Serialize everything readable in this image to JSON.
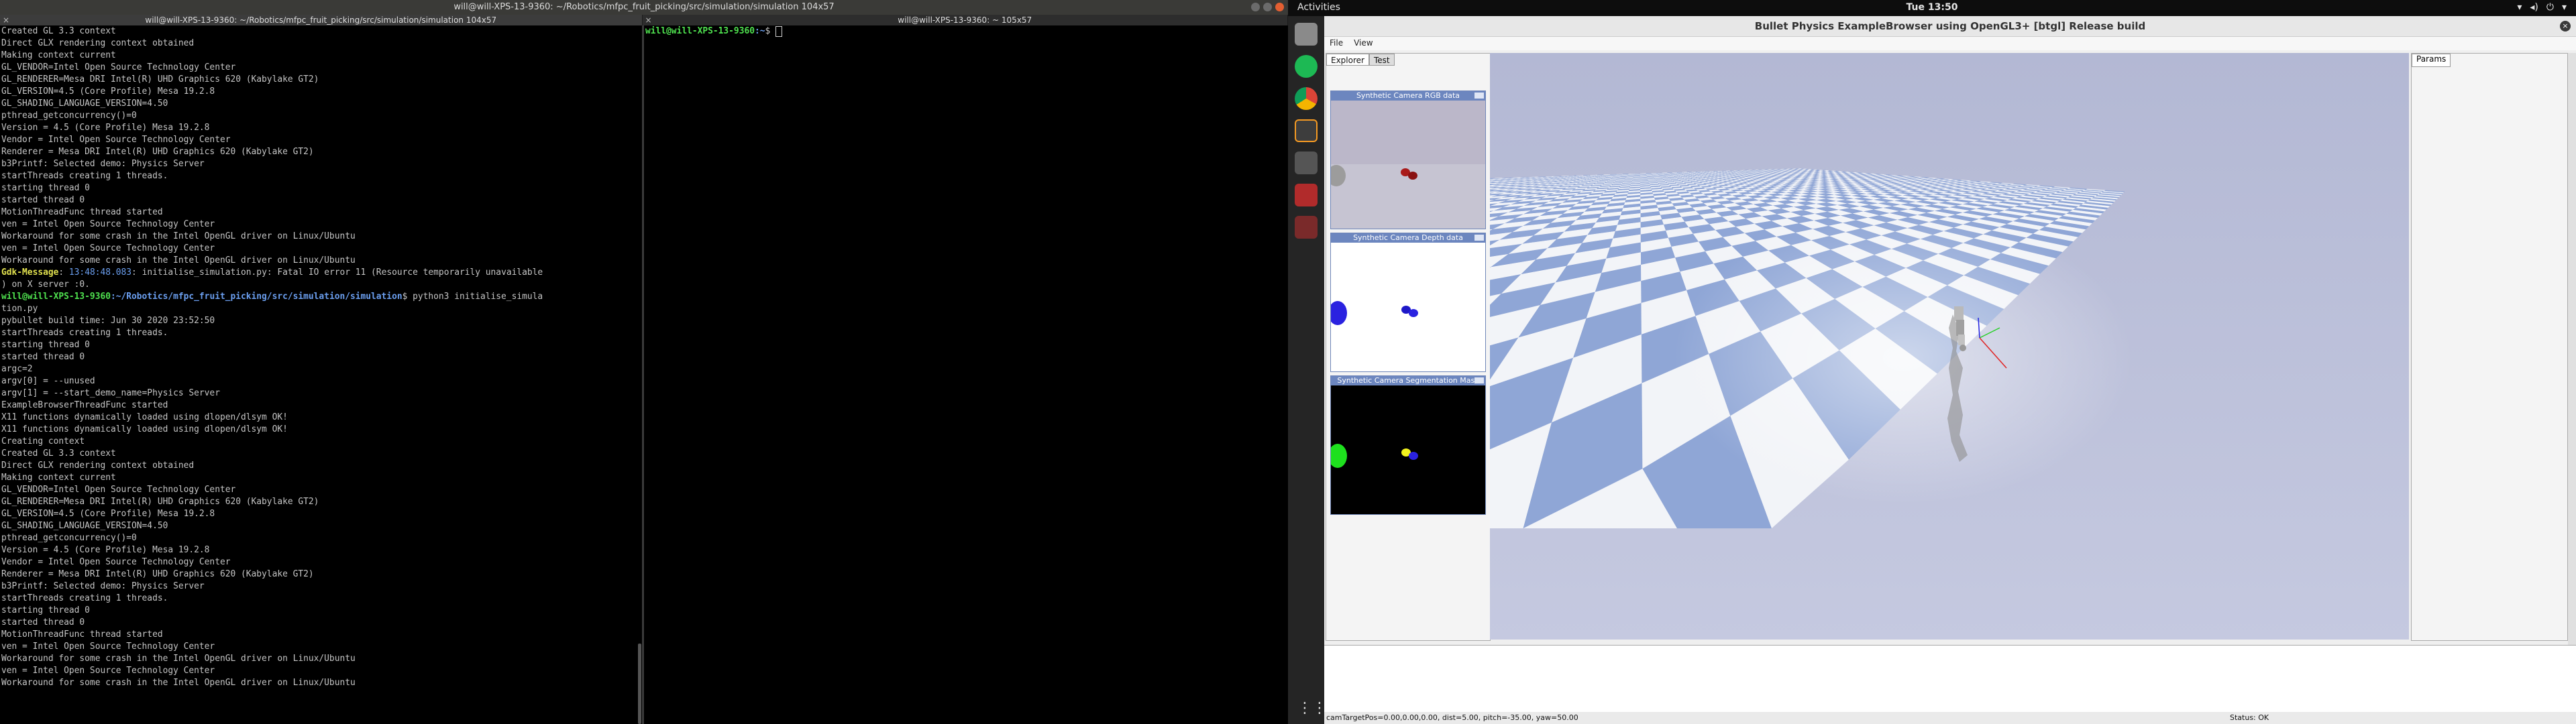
{
  "left_window": {
    "title": "will@will-XPS-13-9360: ~/Robotics/mfpc_fruit_picking/src/simulation/simulation 104x57",
    "tab_left": "will@will-XPS-13-9360: ~/Robotics/mfpc_fruit_picking/src/simulation/simulation 104x57",
    "tab_right": "will@will-XPS-13-9360: ~ 105x57",
    "close_glyph": "×",
    "lines_top": [
      "Created GL 3.3 context",
      "Direct GLX rendering context obtained",
      "Making context current",
      "GL_VENDOR=Intel Open Source Technology Center",
      "GL_RENDERER=Mesa DRI Intel(R) UHD Graphics 620 (Kabylake GT2)",
      "GL_VERSION=4.5 (Core Profile) Mesa 19.2.8",
      "GL_SHADING_LANGUAGE_VERSION=4.50",
      "pthread_getconcurrency()=0",
      "Version = 4.5 (Core Profile) Mesa 19.2.8",
      "Vendor = Intel Open Source Technology Center",
      "Renderer = Mesa DRI Intel(R) UHD Graphics 620 (Kabylake GT2)",
      "b3Printf: Selected demo: Physics Server",
      "startThreads creating 1 threads.",
      "starting thread 0",
      "started thread 0",
      "MotionThreadFunc thread started",
      "ven = Intel Open Source Technology Center",
      "Workaround for some crash in the Intel OpenGL driver on Linux/Ubuntu",
      "ven = Intel Open Source Technology Center",
      "Workaround for some crash in the Intel OpenGL driver on Linux/Ubuntu"
    ],
    "gdk_label": "Gdk-Message",
    "gdk_time": "13:48:48.083",
    "gdk_rest": ": initialise_simulation.py: Fatal IO error 11 (Resource temporarily unavailable",
    "gdk_cont": ") on X server :0.",
    "prompt_user": "will@will-XPS-13-9360",
    "prompt_path": ":~/Robotics/mfpc_fruit_picking/src/simulation/simulation",
    "prompt_cmd": "$ python3 initialise_simula",
    "prompt_cmd_cont": "tion.py",
    "lines_bottom": [
      "pybullet build time: Jun 30 2020 23:52:50",
      "startThreads creating 1 threads.",
      "starting thread 0",
      "started thread 0",
      "argc=2",
      "argv[0] = --unused",
      "argv[1] = --start_demo_name=Physics Server",
      "ExampleBrowserThreadFunc started",
      "X11 functions dynamically loaded using dlopen/dlsym OK!",
      "X11 functions dynamically loaded using dlopen/dlsym OK!",
      "Creating context",
      "Created GL 3.3 context",
      "Direct GLX rendering context obtained",
      "Making context current",
      "GL_VENDOR=Intel Open Source Technology Center",
      "GL_RENDERER=Mesa DRI Intel(R) UHD Graphics 620 (Kabylake GT2)",
      "GL_VERSION=4.5 (Core Profile) Mesa 19.2.8",
      "GL_SHADING_LANGUAGE_VERSION=4.50",
      "pthread_getconcurrency()=0",
      "Version = 4.5 (Core Profile) Mesa 19.2.8",
      "Vendor = Intel Open Source Technology Center",
      "Renderer = Mesa DRI Intel(R) UHD Graphics 620 (Kabylake GT2)",
      "b3Printf: Selected demo: Physics Server",
      "startThreads creating 1 threads.",
      "starting thread 0",
      "started thread 0",
      "MotionThreadFunc thread started",
      "ven = Intel Open Source Technology Center",
      "Workaround for some crash in the Intel OpenGL driver on Linux/Ubuntu",
      "ven = Intel Open Source Technology Center",
      "Workaround for some crash in the Intel OpenGL driver on Linux/Ubuntu"
    ],
    "right_prompt_user": "will@will-XPS-13-9360",
    "right_prompt_path": ":~",
    "right_prompt_sym": "$ "
  },
  "topbar": {
    "activities": "Activities",
    "clock": "Tue 13:50",
    "tray": [
      "▾",
      "◂)",
      "⏻",
      "▾"
    ]
  },
  "dock": {
    "apps_glyph": "⋮⋮⋮"
  },
  "app": {
    "title": "Bullet Physics ExampleBrowser using OpenGL3+ [btgl] Release build",
    "close_glyph": "×",
    "menu": [
      "File",
      "View"
    ],
    "explorer_tabs": [
      "Explorer",
      "Test"
    ],
    "cam_rgb": "Synthetic Camera RGB data",
    "cam_depth": "Synthetic Camera Depth data",
    "cam_seg": "Synthetic Camera Segmentation Mask",
    "params_tab": "Params",
    "status_left": "camTargetPos=0.00,0.00,0.00, dist=5.00, pitch=-35.00, yaw=50.00",
    "status_right": "Status: OK"
  },
  "colors": {
    "prompt_green": "#4fe24f",
    "prompt_blue": "#6b9ff0",
    "checker_light": "#f2f4f8",
    "checker_dark": "#8fa6d6"
  }
}
